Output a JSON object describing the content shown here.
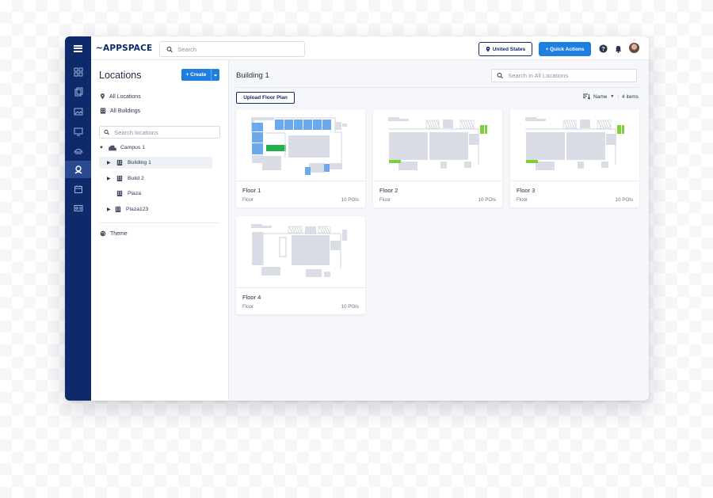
{
  "app": {
    "logo": "APPSPACE"
  },
  "topbar": {
    "search_placeholder": "Search",
    "country_label": "United States",
    "quick_actions_label": "+ Quick Actions"
  },
  "sidebar": {
    "title": "Locations",
    "create_label": "+ Create",
    "links": [
      {
        "label": "All Locations",
        "icon": "map-pin-icon"
      },
      {
        "label": "All Buildings",
        "icon": "building-icon"
      }
    ],
    "search_placeholder": "Search locations",
    "tree": [
      {
        "label": "Campus 1",
        "icon": "campus-icon",
        "expanded": true,
        "level": 0
      },
      {
        "label": "Building 1",
        "icon": "building-icon",
        "selected": true,
        "level": 1
      },
      {
        "label": "Build 2",
        "icon": "building-icon",
        "level": 1
      },
      {
        "label": "Plaza",
        "icon": "building-icon",
        "level": 1
      },
      {
        "label": "Plaza123",
        "icon": "building-icon",
        "level": 0
      }
    ],
    "theme_label": "Theme"
  },
  "main": {
    "title": "Building 1",
    "search_placeholder": "Search in All Locations",
    "upload_label": "Upload Floor Plan",
    "sort_label": "Name",
    "count_label": "4 items",
    "floors": [
      {
        "name": "Floor 1",
        "type": "Floor",
        "pois": "10 POIs"
      },
      {
        "name": "Floor 2",
        "type": "Floor",
        "pois": "10 POIs"
      },
      {
        "name": "Floor 3",
        "type": "Floor",
        "pois": "10 POIs"
      },
      {
        "name": "Floor 4",
        "type": "Floor",
        "pois": "10 POIs"
      }
    ]
  },
  "colors": {
    "rail": "#0f2a6b",
    "accent": "#1f7fe0",
    "room_gray": "#dadde6",
    "room_blue": "#6aa9ec",
    "room_green": "#22b14c",
    "room_lime": "#7ed03a"
  }
}
